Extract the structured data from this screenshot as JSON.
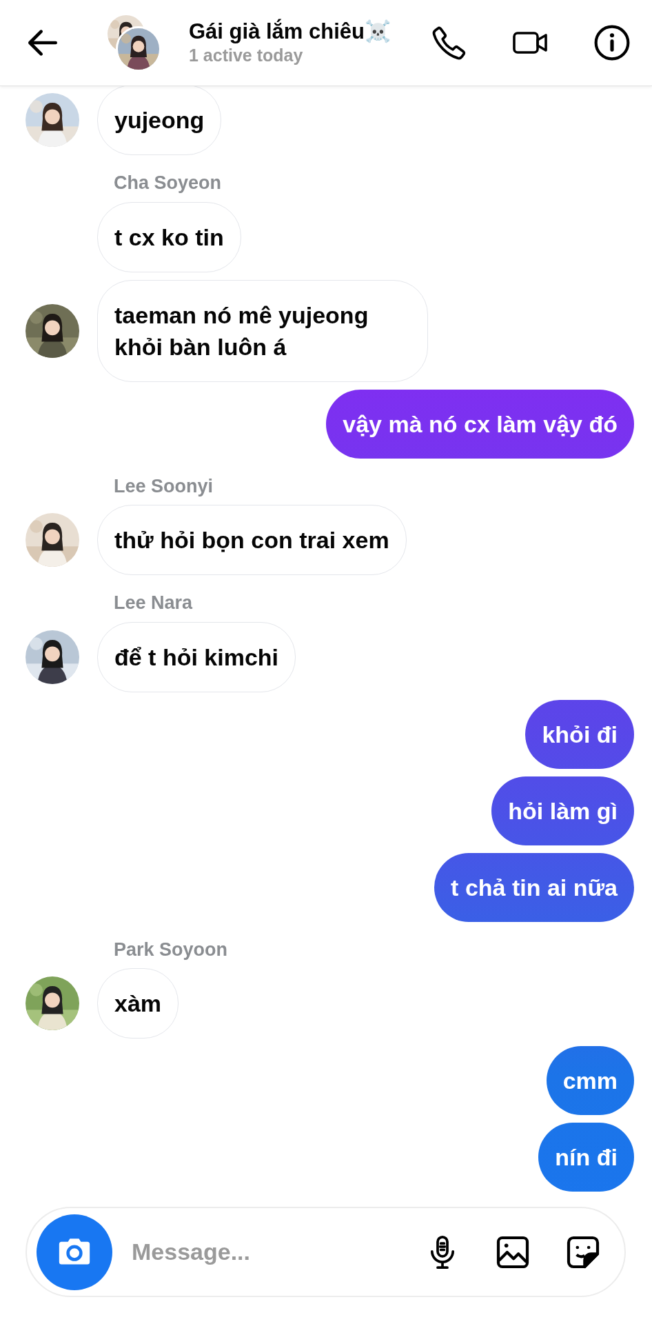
{
  "header": {
    "title": "Gái già lắm chiêu☠️",
    "subtitle": "1 active today"
  },
  "messages": [
    {
      "kind": "incoming",
      "text": "yujeong",
      "avatar": true
    },
    {
      "kind": "sender",
      "text": "Cha Soyeon"
    },
    {
      "kind": "incoming",
      "text": "t cx ko tin",
      "avatar": false
    },
    {
      "kind": "incoming",
      "text": "taeman nó mê yujeong khỏi bàn luôn á",
      "avatar": true
    },
    {
      "kind": "outgoing",
      "text": "vậy mà nó cx làm vậy đó"
    },
    {
      "kind": "sender",
      "text": "Lee Soonyi"
    },
    {
      "kind": "incoming",
      "text": "thử hỏi bọn con trai xem",
      "avatar": true
    },
    {
      "kind": "sender",
      "text": "Lee Nara"
    },
    {
      "kind": "incoming",
      "text": "để t hỏi kimchi",
      "avatar": true
    },
    {
      "kind": "outgoing",
      "text": "khỏi đi"
    },
    {
      "kind": "outgoing",
      "text": "hỏi làm gì"
    },
    {
      "kind": "outgoing",
      "text": "t chả tin ai nữa"
    },
    {
      "kind": "sender",
      "text": "Park Soyoon"
    },
    {
      "kind": "incoming",
      "text": "xàm",
      "avatar": true
    },
    {
      "kind": "outgoing",
      "text": "cmm"
    },
    {
      "kind": "outgoing",
      "text": "nín đi"
    }
  ],
  "composer": {
    "placeholder": "Message..."
  }
}
